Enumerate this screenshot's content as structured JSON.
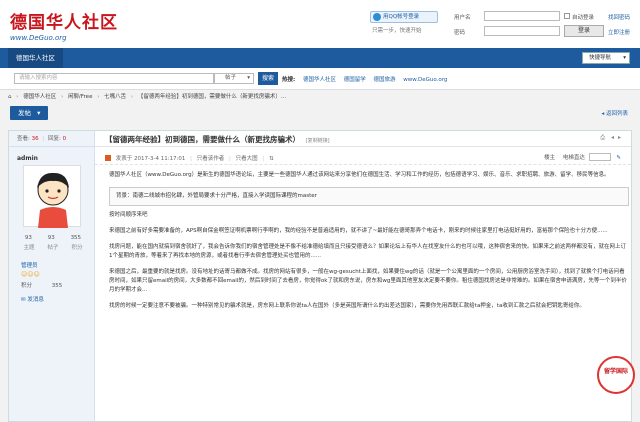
{
  "header": {
    "logo_text": "德国华人社区",
    "logo_url": "www.DeGuo.org",
    "qq_login": "用QQ帐号登录",
    "qq_sub": "只需一步，快速开始",
    "username_label": "用户名",
    "password_label": "密码",
    "auto_login": "自动登录",
    "forgot": "找回密码",
    "register": "立即注册",
    "login_button": "登录"
  },
  "nav": {
    "active": "德国华人社区",
    "quick_nav": "快捷导航"
  },
  "search": {
    "placeholder": "请输入搜索内容",
    "scope": "帖子",
    "button": "搜索",
    "hot_label": "热搜:",
    "hot_items": [
      "德国华人社区",
      "德国留学",
      "德国旅游",
      "www.DeGuo.org"
    ]
  },
  "breadcrumb": [
    "德国华人社区",
    "闲聊/Free",
    "七嘴八舌",
    "【留德两年经验】初到德国，需要做什么（新更找房骗术）..."
  ],
  "actions": {
    "post": "发帖",
    "back": "返回列表"
  },
  "thread": {
    "views_label": "查看:",
    "views": "36",
    "replies_label": "回复:",
    "replies": "0",
    "title": "【留德两年经验】初到德国，需要做什么（新更找房骗术）",
    "copy_link": "[复制链接]",
    "author": "admin",
    "posted": "发表于 2017-3-4 11:17:01",
    "only_author": "只看该作者",
    "only_images": "只看大图",
    "floor": "楼主",
    "ebook_size": "电梯直达",
    "user_stats": [
      "93",
      "93",
      "355"
    ],
    "user_stat_labels": [
      "主题",
      "帖子",
      "积分"
    ],
    "group": "管理员",
    "points_label": "积分",
    "points": "355",
    "send_msg": "发消息",
    "paragraphs": [
      "德国华人社区（www.DeGuo.org）是新生的德国华语论坛，主要是一些德国华人通过该网站来分享他们在德国生活、学习和工作的经历，包括德语学习、娱乐、音乐、求职招聘、旅游、留学、移民等信息。",
      "背景：南德二线城市招化肆，外管局要求十分严格，直接入学读国际课程的master",
      "按时间顺序来吧",
      "来德国之前有好多需要准备的，APS啊自保金啊签证啊机票啊行李啊的，我的经验不是普遍适用的，就不讲了~最好能在德哥那弄个电话卡，刚来的时候往家里打电话挺好用的，富裕那个保险也十分方便......",
      "找房问题，能在国内就搞到宿舍就好了，我会告诉你我们的宿舍管理处是不像不给准德给填而且只接受德语么？如果论坛上有华人在找室友什么的也可以哦，这种宿舍来的快。如果来之前这两样都没有，就在网上订1个星期的青旅，等着来了再找本地的房源，或者找看行李去宿舍管理处买也管用的......",
      "来德国之后，最重要的就是找房。没有地址的话寄马都做不成。找房的网站有很多，一般在wg-gesucht上面找，如果要住wg的话（就是一个公寓里面的一个房间，公用厨房浴室洗手间），找到了就换个打电话问看房时间，如果只留email的房间，大多数都不回email的，然后到时间了去看房，你觉得ok了就和房东说，房东和wg里面其他室友决定要不要你。租住德国找房这是非常难的。如果在宿舍申请满房，先等一个到半价月的学期才会..."
    ],
    "para_last": "找房的时候一定要注意不要被骗。一种特别常见的骗术就是，房东网上联系你说ta人在国外（多是英国所谓什么的出差达国家），需要你先用西联汇款给ta押金，ta收到汇款之后就会把钥匙寄给你。"
  },
  "badge": {
    "text": "留学国际"
  }
}
